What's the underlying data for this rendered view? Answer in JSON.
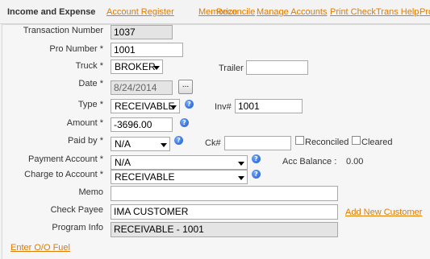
{
  "header": {
    "title": "Income and Expense",
    "nav": [
      "Account Register",
      "Memorize",
      "Reconcile",
      "Manage Accounts",
      "Print Check",
      "Trans Help",
      "Pro"
    ]
  },
  "form": {
    "transaction_number": {
      "label": "Transaction Number",
      "value": "1037"
    },
    "pro_number": {
      "label": "Pro Number *",
      "value": "1001"
    },
    "truck": {
      "label": "Truck *",
      "value": "BROKER"
    },
    "trailer": {
      "label": "Trailer",
      "value": ""
    },
    "date": {
      "label": "Date *",
      "value": "8/24/2014",
      "button": "..."
    },
    "type": {
      "label": "Type *",
      "value": "RECEIVABLE"
    },
    "inv": {
      "label": "Inv#",
      "value": "1001"
    },
    "amount": {
      "label": "Amount *",
      "value": "-3696.00"
    },
    "paid_by": {
      "label": "Paid by *",
      "value": "N/A"
    },
    "ck": {
      "label": "Ck#",
      "value": ""
    },
    "reconciled": {
      "label": "Reconciled",
      "checked": false
    },
    "cleared": {
      "label": "Cleared",
      "checked": false
    },
    "payment_account": {
      "label": "Payment Account *",
      "value": "N/A"
    },
    "acc_balance": {
      "label": "Acc Balance :",
      "value": "0.00"
    },
    "charge_to_account": {
      "label": "Charge to Account *",
      "value": "RECEIVABLE"
    },
    "memo": {
      "label": "Memo",
      "value": ""
    },
    "check_payee": {
      "label": "Check Payee",
      "value": "IMA CUSTOMER"
    },
    "add_new_customer": "Add New Customer",
    "program_info": {
      "label": "Program Info",
      "value": "RECEIVABLE - 1001"
    },
    "help_icon": "?"
  },
  "footer": {
    "link": "Enter O/O Fuel"
  },
  "colors": {
    "link": "#e07b00",
    "help_icon": "#1e57c8"
  }
}
